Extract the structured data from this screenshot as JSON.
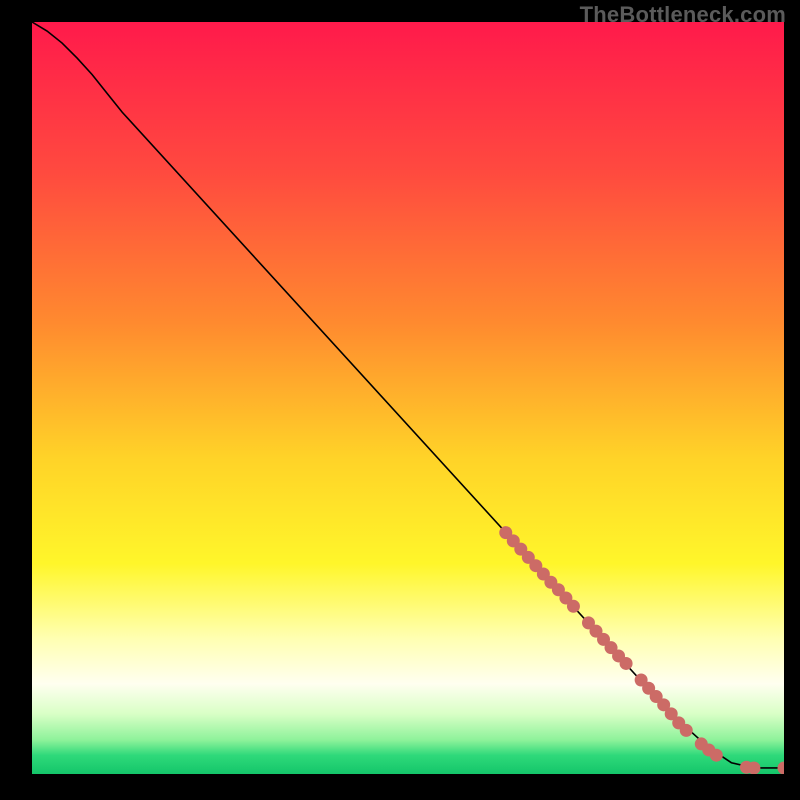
{
  "watermark": "TheBottleneck.com",
  "chart_data": {
    "type": "line",
    "title": "",
    "xlabel": "",
    "ylabel": "",
    "xlim": [
      0,
      100
    ],
    "ylim": [
      0,
      100
    ],
    "grid": false,
    "legend": false,
    "background": {
      "type": "vertical-gradient",
      "stops": [
        {
          "offset": 0.0,
          "color": "#ff1a4b"
        },
        {
          "offset": 0.2,
          "color": "#ff4a3f"
        },
        {
          "offset": 0.4,
          "color": "#ff8a2f"
        },
        {
          "offset": 0.58,
          "color": "#ffd328"
        },
        {
          "offset": 0.72,
          "color": "#fff62a"
        },
        {
          "offset": 0.82,
          "color": "#ffffb2"
        },
        {
          "offset": 0.88,
          "color": "#fffff0"
        },
        {
          "offset": 0.92,
          "color": "#d9ffc6"
        },
        {
          "offset": 0.955,
          "color": "#8df29a"
        },
        {
          "offset": 0.975,
          "color": "#2fd97a"
        },
        {
          "offset": 1.0,
          "color": "#14c66a"
        }
      ]
    },
    "series": [
      {
        "name": "curve",
        "color": "#000000",
        "marker": false,
        "points": [
          {
            "x": 0,
            "y": 100
          },
          {
            "x": 2,
            "y": 98.8
          },
          {
            "x": 4,
            "y": 97.2
          },
          {
            "x": 6,
            "y": 95.2
          },
          {
            "x": 8,
            "y": 93.0
          },
          {
            "x": 10,
            "y": 90.5
          },
          {
            "x": 12,
            "y": 88.0
          },
          {
            "x": 85,
            "y": 8.0
          },
          {
            "x": 90,
            "y": 3.5
          },
          {
            "x": 93,
            "y": 1.5
          },
          {
            "x": 96,
            "y": 0.8
          },
          {
            "x": 100,
            "y": 0.8
          }
        ]
      },
      {
        "name": "dots",
        "color": "#cc6b66",
        "marker": true,
        "points": [
          {
            "x": 63.0,
            "y": 32.1
          },
          {
            "x": 64.0,
            "y": 31.0
          },
          {
            "x": 65.0,
            "y": 29.9
          },
          {
            "x": 66.0,
            "y": 28.8
          },
          {
            "x": 67.0,
            "y": 27.7
          },
          {
            "x": 68.0,
            "y": 26.6
          },
          {
            "x": 69.0,
            "y": 25.5
          },
          {
            "x": 70.0,
            "y": 24.5
          },
          {
            "x": 71.0,
            "y": 23.4
          },
          {
            "x": 72.0,
            "y": 22.3
          },
          {
            "x": 74.0,
            "y": 20.1
          },
          {
            "x": 75.0,
            "y": 19.0
          },
          {
            "x": 76.0,
            "y": 17.9
          },
          {
            "x": 77.0,
            "y": 16.8
          },
          {
            "x": 78.0,
            "y": 15.7
          },
          {
            "x": 79.0,
            "y": 14.7
          },
          {
            "x": 81.0,
            "y": 12.5
          },
          {
            "x": 82.0,
            "y": 11.4
          },
          {
            "x": 83.0,
            "y": 10.3
          },
          {
            "x": 84.0,
            "y": 9.2
          },
          {
            "x": 85.0,
            "y": 8.0
          },
          {
            "x": 86.0,
            "y": 6.8
          },
          {
            "x": 87.0,
            "y": 5.8
          },
          {
            "x": 89.0,
            "y": 4.0
          },
          {
            "x": 90.0,
            "y": 3.2
          },
          {
            "x": 91.0,
            "y": 2.5
          },
          {
            "x": 95.0,
            "y": 0.9
          },
          {
            "x": 96.0,
            "y": 0.8
          },
          {
            "x": 100.0,
            "y": 0.8
          }
        ]
      }
    ]
  }
}
